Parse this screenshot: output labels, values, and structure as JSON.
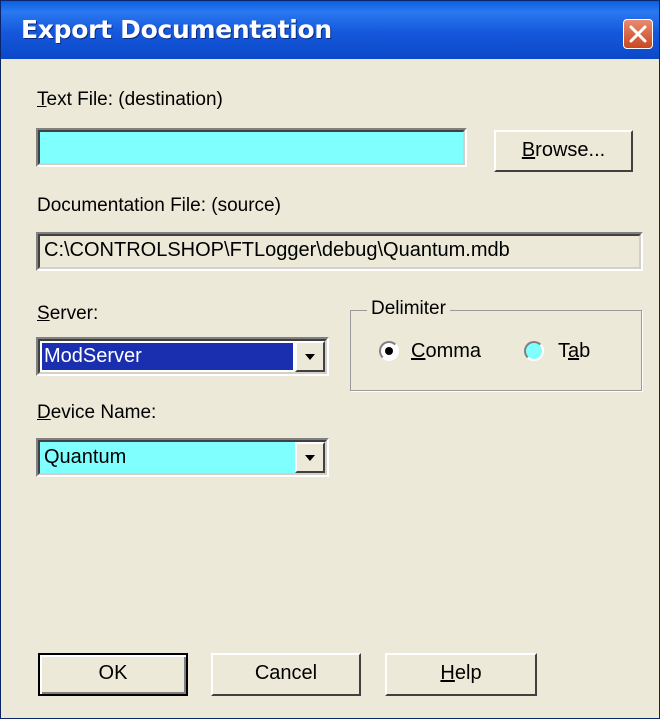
{
  "window": {
    "title": "Export Documentation"
  },
  "text_file": {
    "label_hotkey": "T",
    "label_rest": "ext File: (destination)",
    "value": "",
    "browse_hotkey": "B",
    "browse_rest": "rowse..."
  },
  "doc_file": {
    "label": "Documentation File: (source)",
    "value": "C:\\CONTROLSHOP\\FTLogger\\debug\\Quantum.mdb"
  },
  "server": {
    "label_hotkey": "S",
    "label_rest": "erver:",
    "selected": "ModServer"
  },
  "device": {
    "label_hotkey": "D",
    "label_rest": "evice Name:",
    "selected": "Quantum"
  },
  "delimiter": {
    "title": "Delimiter",
    "options": [
      {
        "hotkey": "C",
        "rest": "omma",
        "checked": true
      },
      {
        "pre": "T",
        "hotkey": "a",
        "rest": "b",
        "checked": false
      }
    ]
  },
  "buttons": {
    "ok": "OK",
    "cancel": "Cancel",
    "help_hotkey": "H",
    "help_rest": "elp"
  },
  "colors": {
    "title_bar": "#0b49c8",
    "input_bg": "#80ffff",
    "selected_bg": "#1a2fb0",
    "dialog_bg": "#ece9d8"
  },
  "icons": [
    "close-icon",
    "chevron-down-icon",
    "radio-checked-icon",
    "radio-unchecked-icon"
  ]
}
